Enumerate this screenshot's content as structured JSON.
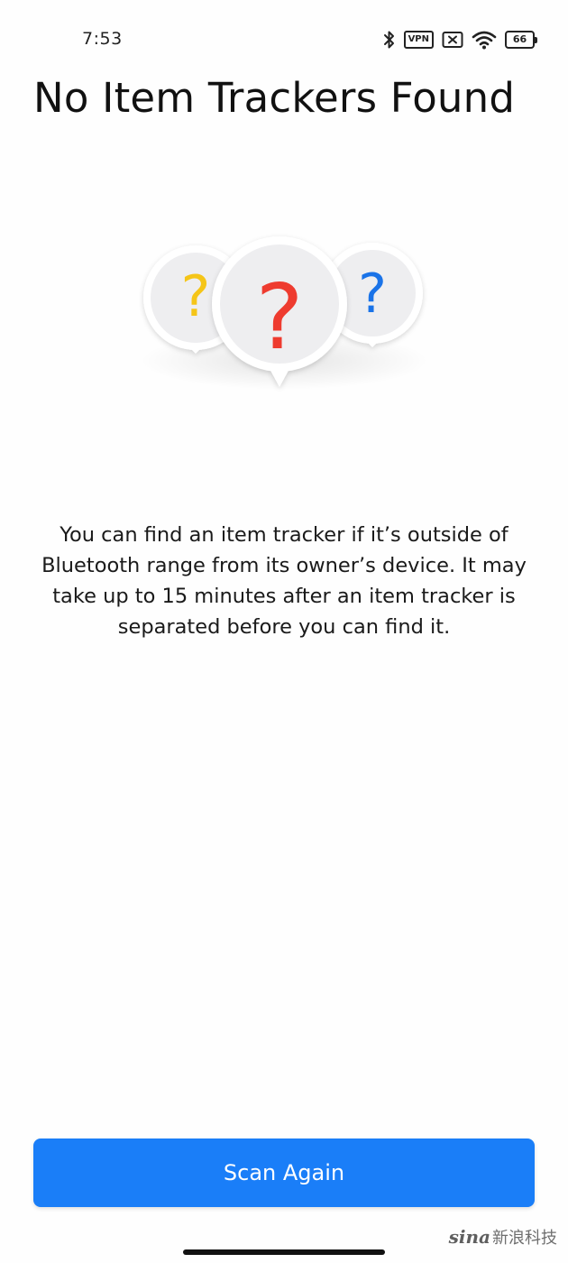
{
  "status_bar": {
    "time": "7:53",
    "vpn_label": "VPN",
    "battery_level": "66",
    "icons": [
      "bluetooth-icon",
      "vpn-icon",
      "no-sim-icon",
      "wifi-icon",
      "battery-icon"
    ]
  },
  "page": {
    "title": "No Item Trackers Found",
    "description": "You can find an item tracker if it’s outside of Bluetooth range from its owner’s device. It may take up to 15 minutes after an item tracker is separated before you can find it."
  },
  "illustration": {
    "markers": [
      {
        "glyph": "?",
        "color": "#f5c518"
      },
      {
        "glyph": "?",
        "color": "#ee3b2f"
      },
      {
        "glyph": "?",
        "color": "#1a73e8"
      }
    ]
  },
  "actions": {
    "scan_again_label": "Scan Again"
  },
  "watermark": {
    "logo": "sina",
    "text": "新浪科技"
  },
  "colors": {
    "accent": "#1a7ef8",
    "background": "#fefefe"
  }
}
